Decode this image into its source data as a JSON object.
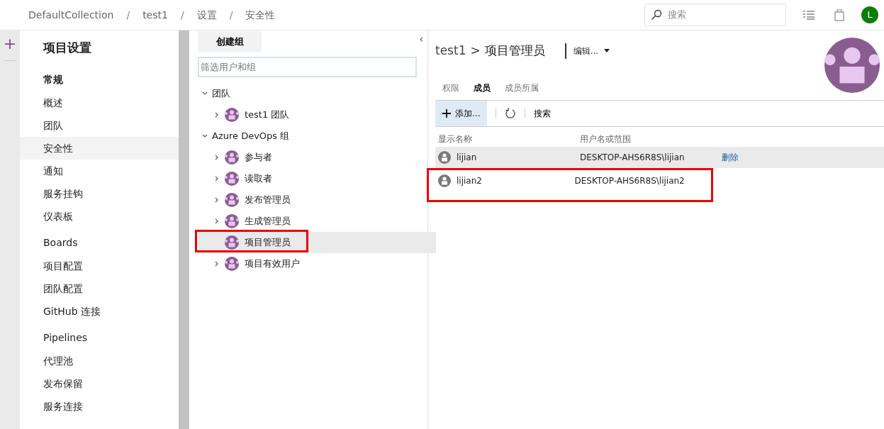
{
  "breadcrumb": {
    "separator": "/",
    "items": [
      "DefaultCollection",
      "test1",
      "设置",
      "安全性"
    ]
  },
  "header": {
    "search_placeholder": "搜索",
    "avatar": "L"
  },
  "rail": {
    "add": "+"
  },
  "sidebar": {
    "title": "项目设置",
    "sections": [
      {
        "heading": "常规",
        "items": [
          {
            "label": "概述",
            "selected": false
          },
          {
            "label": "团队",
            "selected": false
          },
          {
            "label": "安全性",
            "selected": true
          },
          {
            "label": "通知",
            "selected": false
          },
          {
            "label": "服务挂钩",
            "selected": false
          },
          {
            "label": "仪表板",
            "selected": false
          }
        ]
      },
      {
        "heading": "Boards",
        "items": [
          {
            "label": "项目配置",
            "selected": false
          },
          {
            "label": "团队配置",
            "selected": false
          },
          {
            "label": "GitHub 连接",
            "selected": false
          }
        ]
      },
      {
        "heading": "Pipelines",
        "items": [
          {
            "label": "代理池",
            "selected": false
          },
          {
            "label": "发布保留",
            "selected": false
          },
          {
            "label": "服务连接",
            "selected": false
          }
        ]
      }
    ]
  },
  "groups": {
    "create_button": "创建组",
    "collapse": "‹",
    "filter_placeholder": "筛选用户和组",
    "tree": [
      {
        "label": "团队",
        "expanded": true,
        "children": [
          {
            "label": "test1 团队",
            "expandable": true,
            "selected": false,
            "highlighted": false
          }
        ]
      },
      {
        "label": "Azure DevOps 组",
        "expanded": true,
        "children": [
          {
            "label": "参与者",
            "expandable": true,
            "selected": false,
            "highlighted": false
          },
          {
            "label": "读取者",
            "expandable": true,
            "selected": false,
            "highlighted": false
          },
          {
            "label": "发布管理员",
            "expandable": true,
            "selected": false,
            "highlighted": false
          },
          {
            "label": "生成管理员",
            "expandable": true,
            "selected": false,
            "highlighted": false
          },
          {
            "label": "项目管理员",
            "expandable": false,
            "selected": true,
            "highlighted": true
          },
          {
            "label": "项目有效用户",
            "expandable": true,
            "selected": false,
            "highlighted": false
          }
        ]
      }
    ]
  },
  "detail": {
    "project": "test1",
    "separator": ">",
    "title": "项目管理员",
    "edit_menu": "编辑...",
    "tabs": [
      {
        "label": "权限",
        "selected": false
      },
      {
        "label": "成员",
        "selected": true
      },
      {
        "label": "成员所属",
        "selected": false
      }
    ],
    "toolbar": {
      "add": "添加...",
      "search": "搜索"
    },
    "columns": [
      "显示名称",
      "用户名或范围"
    ],
    "rows": [
      {
        "name": "lijian",
        "account": "DESKTOP-AHS6R8S\\lijian",
        "action": "删除",
        "selected": true,
        "highlighted": false
      },
      {
        "name": "lijian2",
        "account": "DESKTOP-AHS6R8S\\lijian2",
        "selected": false,
        "highlighted": true
      }
    ]
  }
}
